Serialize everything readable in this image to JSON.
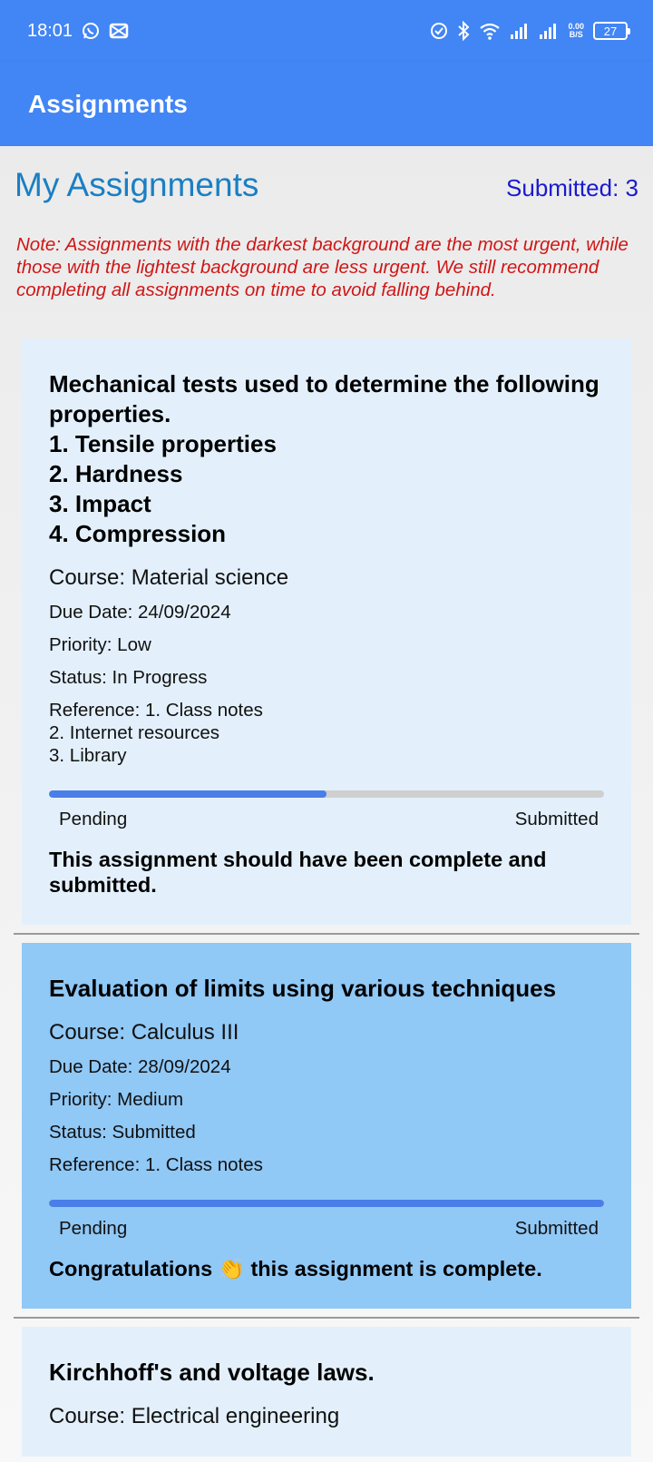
{
  "status_bar": {
    "time": "18:01",
    "net_speed_top": "0.00",
    "net_speed_bottom": "B/S",
    "battery": "27"
  },
  "app_bar": {
    "title": "Assignments"
  },
  "page": {
    "title": "My Assignments",
    "submitted_label": "Submitted: 3",
    "note": "Note: Assignments with the darkest background are the most urgent, while those with the lightest background are less urgent. We still recommend completing all assignments on time to avoid falling behind."
  },
  "assignments": [
    {
      "title": "Mechanical tests used to determine the following properties.\n1. Tensile properties\n2. Hardness\n3. Impact\n4. Compression",
      "course": "Course: Material science",
      "due": "Due Date: 24/09/2024",
      "priority": "Priority: Low",
      "status": "Status: In Progress",
      "reference": "Reference: 1. Class notes\n2. Internet resources\n3. Library",
      "progress": 0.5,
      "pending_label": "Pending",
      "submitted_label": "Submitted",
      "message": "This assignment should have been complete and submitted."
    },
    {
      "title": "Evaluation of limits using various techniques",
      "course": "Course: Calculus III",
      "due": "Due Date: 28/09/2024",
      "priority": "Priority: Medium",
      "status": "Status: Submitted",
      "reference": "Reference: 1. Class notes",
      "progress": 1.0,
      "pending_label": "Pending",
      "submitted_label": "Submitted",
      "message": "Congratulations 👏 this assignment is complete."
    },
    {
      "title": "Kirchhoff's and voltage laws.",
      "course": "Course: Electrical engineering"
    }
  ],
  "colors": {
    "primary": "#4285f4",
    "title_blue": "#1a7fc4",
    "note_red": "#d01616",
    "card_light": "#e3f0fc",
    "card_medium": "#90c8f6",
    "progress_fill": "#4a7ee8"
  }
}
